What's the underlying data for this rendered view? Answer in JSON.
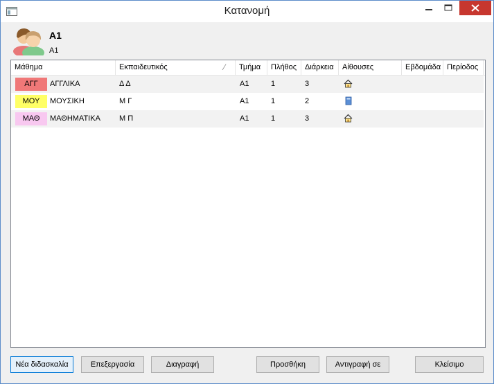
{
  "window": {
    "title": "Κατανομή"
  },
  "header": {
    "name": "A1",
    "subtitle": "A1"
  },
  "table": {
    "columns": [
      "Μάθημα",
      "Εκπαιδευτικός",
      "Τμήμα",
      "Πλήθος",
      "Διάρκεια",
      "Αίθουσες",
      "Εβδομάδα",
      "Περίοδος"
    ],
    "rows": [
      {
        "code": "ΑΓΓ",
        "color": "#f07878",
        "subject": "ΑΓΓΛΙΚΑ",
        "teacher": "Δ Δ",
        "class": "A1",
        "count": "1",
        "duration": "3",
        "room": "house-icon"
      },
      {
        "code": "ΜΟΥ",
        "color": "#ffff66",
        "subject": "ΜΟΥΣΙΚΗ",
        "teacher": "Μ Γ",
        "class": "A1",
        "count": "1",
        "duration": "2",
        "room": "book-icon"
      },
      {
        "code": "ΜΑΘ",
        "color": "#f8c8f0",
        "subject": "ΜΑΘΗΜΑΤΙΚΑ",
        "teacher": "Μ Π",
        "class": "A1",
        "count": "1",
        "duration": "3",
        "room": "house-icon"
      }
    ]
  },
  "buttons": {
    "new": "Νέα διδασκαλία",
    "edit": "Επεξεργασία",
    "delete": "Διαγραφή",
    "add": "Προσθήκη",
    "copy": "Αντιγραφή σε",
    "close": "Κλείσιμο"
  }
}
